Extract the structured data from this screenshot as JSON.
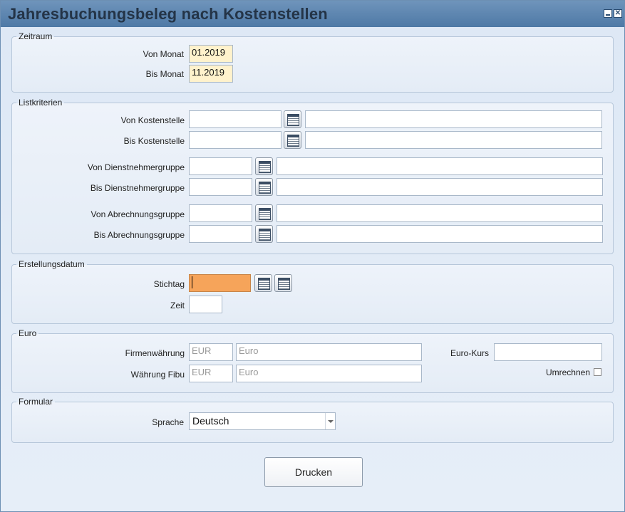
{
  "window": {
    "title": "Jahresbuchungsbeleg nach Kostenstellen"
  },
  "zeitraum": {
    "legend": "Zeitraum",
    "von_monat_label": "Von Monat",
    "von_monat_value": "01.2019",
    "bis_monat_label": "Bis Monat",
    "bis_monat_value": "11.2019"
  },
  "listkriterien": {
    "legend": "Listkriterien",
    "von_kostenstelle_label": "Von Kostenstelle",
    "bis_kostenstelle_label": "Bis Kostenstelle",
    "von_dienstnehmergruppe_label": "Von Dienstnehmergruppe",
    "bis_dienstnehmergruppe_label": "Bis Dienstnehmergruppe",
    "von_abrechnungsgruppe_label": "Von Abrechnungsgruppe",
    "bis_abrechnungsgruppe_label": "Bis Abrechnungsgruppe"
  },
  "erstellungsdatum": {
    "legend": "Erstellungsdatum",
    "stichtag_label": "Stichtag",
    "zeit_label": "Zeit"
  },
  "euro": {
    "legend": "Euro",
    "firmenwaehrung_label": "Firmenwährung",
    "firmenwaehrung_code": "EUR",
    "firmenwaehrung_name": "Euro",
    "waehrung_fibu_label": "Währung Fibu",
    "waehrung_fibu_code": "EUR",
    "waehrung_fibu_name": "Euro",
    "euro_kurs_label": "Euro-Kurs",
    "umrechnen_label": "Umrechnen"
  },
  "formular": {
    "legend": "Formular",
    "sprache_label": "Sprache",
    "sprache_value": "Deutsch"
  },
  "actions": {
    "drucken_label": "Drucken"
  }
}
